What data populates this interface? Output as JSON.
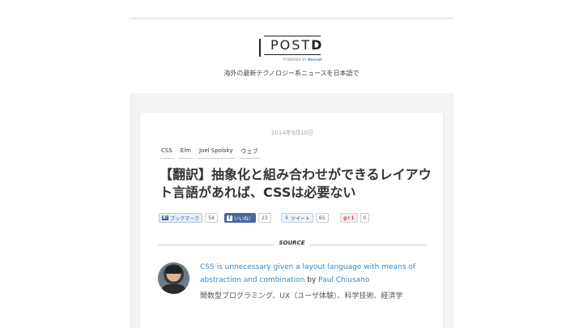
{
  "site": {
    "logo_text": "POST",
    "logo_letter": "D",
    "powered_prefix": "POWERED BY",
    "powered_brand": "Recruit",
    "tagline": "海外の最新テクノロジー系ニュースを日本語で"
  },
  "article": {
    "date": "2014年9月10日",
    "tags": [
      "CSS",
      "Elm",
      "Joel Spolsky",
      "ウェブ"
    ],
    "title": "【翻訳】抽象化と組み合わせができるレイアウト言語があれば、CSSは必要ない"
  },
  "share": {
    "hatena_label": "ブックマーク",
    "hatena_badge": "B!",
    "hatena_count": "54",
    "facebook_label": "いいね！",
    "facebook_count": "23",
    "twitter_label": "ツイート",
    "twitter_count": "65",
    "gplus_label": "g+1",
    "gplus_count": "0"
  },
  "source": {
    "heading": "SOURCE",
    "link_text": "CSS is unnecessary given a layout language with means of abstraction and combination",
    "by": " by ",
    "author": "Paul Chiusano",
    "author_desc": "関数型プログラミング、UX（ユーザ体験）、科学技術、経済学"
  },
  "colors": {
    "link": "#3a87c8",
    "facebook": "#4a66a0",
    "hatena": "#2d5ba1",
    "twitter": "#55acee",
    "gplus": "#d34836"
  }
}
